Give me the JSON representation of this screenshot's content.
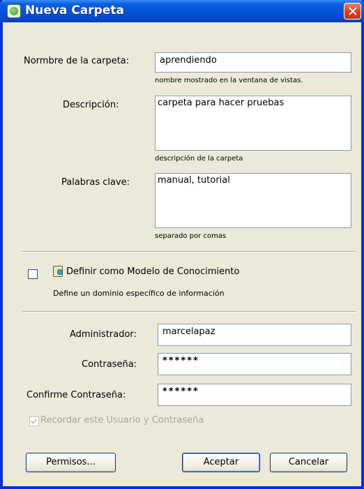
{
  "window": {
    "title": "Nueva Carpeta"
  },
  "folder": {
    "name_label": "Normbre de la carpeta:",
    "name_value": "aprendiendo",
    "name_hint": "nombre mostrado en la ventana de vistas.",
    "description_label": "Descripción:",
    "description_value": "carpeta para hacer pruebas",
    "description_hint": "descripción de la carpeta",
    "keywords_label": "Palabras clave:",
    "keywords_value": "manual, tutorial",
    "keywords_hint": "separado por comas"
  },
  "knowledge_model": {
    "checked": false,
    "label": "Definir como Modelo de Conocimiento",
    "hint": "Define un dominio específico de información"
  },
  "admin": {
    "admin_label": "Administrador:",
    "admin_value": "marcelapaz",
    "password_label": "Contraseña:",
    "password_value": "******",
    "confirm_label": "Confirme Contraseña:",
    "confirm_value": "******",
    "remember_checked": true,
    "remember_label": "Recordar este Usuario y Contraseña"
  },
  "buttons": {
    "permissions": "Permisos...",
    "accept": "Aceptar",
    "cancel": "Cancelar"
  },
  "colors": {
    "titlebar": "#0453d6",
    "window_bg": "#ece9d8",
    "close_button": "#d6401f",
    "input_border": "#7f9db9"
  }
}
